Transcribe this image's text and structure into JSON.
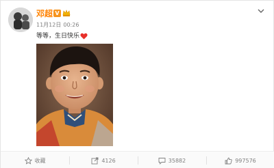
{
  "post": {
    "username": "邓超",
    "verified_badge": "V",
    "date": "11月12日",
    "time": "00:26",
    "text": "等等，生日快乐",
    "heart_icon": "heart-icon",
    "photo_icon": "child-portrait-photo"
  },
  "actions": {
    "favorite_label": "收藏",
    "repost_count": "4126",
    "comment_count": "35882",
    "like_count": "997576"
  },
  "colors": {
    "username": "#ff8200",
    "heart": "#e8302a",
    "meta": "#808080"
  }
}
